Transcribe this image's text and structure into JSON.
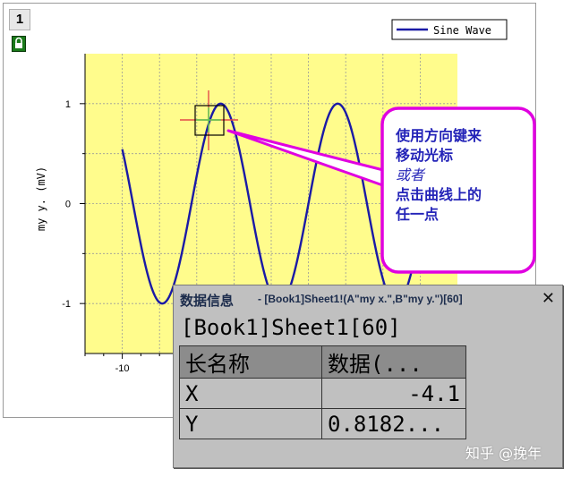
{
  "graph": {
    "layer_number": "1",
    "legend_label": "Sine Wave",
    "ylabel": "my y. (mV)",
    "x_tick_labels": [
      "-10"
    ],
    "y_tick_labels": [
      "1",
      "0",
      "-1"
    ],
    "plot_background": "#fffc8c",
    "line_color": "#1a1aa6"
  },
  "callout": {
    "line1": "使用方向键来",
    "line2": "移动光标",
    "line3": "或者",
    "line4": "点击曲线上的",
    "line5": "任一点",
    "border_color": "#e000e0",
    "text_color": "#2424b8"
  },
  "data_info": {
    "title": "数据信息",
    "source": "- [Book1]Sheet1!(A\"my x.\",B\"my y.\")[60]",
    "close_glyph": "✕",
    "location": "[Book1]Sheet1[60]",
    "headers": [
      "长名称",
      "数据(..."
    ],
    "rows": [
      {
        "name": "X",
        "value": "-4.1"
      },
      {
        "name": "Y",
        "value": "0.8182..."
      }
    ]
  },
  "watermark": "知乎 @挽年",
  "chart_data": {
    "type": "line",
    "series": [
      {
        "name": "Sine Wave"
      }
    ],
    "function": "sin",
    "xlim": [
      -12,
      8
    ],
    "ylim": [
      -1.5,
      1.5
    ],
    "x_ticks": [
      -10
    ],
    "y_ticks": [
      1,
      0,
      -1
    ],
    "grid": true,
    "legend": "top-right",
    "cursor": {
      "x": -4.1,
      "y": 0.8182
    }
  }
}
